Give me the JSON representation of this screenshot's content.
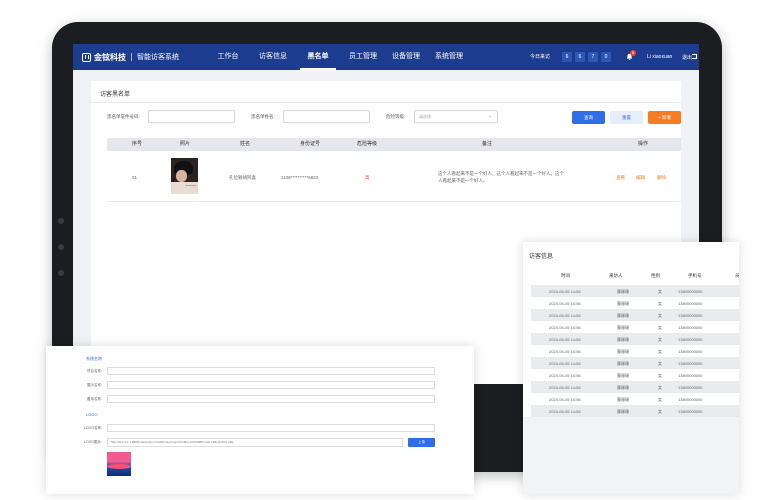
{
  "topbar": {
    "brand_name": "金铉科技",
    "brand_sub": "智能访客系统",
    "nav": [
      "工作台",
      "访客信息",
      "黑名单",
      "员工管理",
      "设备管理",
      "系统管理"
    ],
    "active_nav": "黑名单",
    "count_label": "今日来访",
    "count_digits": [
      "6",
      "6",
      "7",
      "0"
    ],
    "notification_count": "5",
    "user_name": "Li xiaoxuan",
    "logout_label": "退出"
  },
  "blacklist": {
    "title": "访客黑名单",
    "filters": {
      "id_label": "黑名单证件号码:",
      "name_label": "黑名单姓名:",
      "level_label": "危险等级:",
      "level_placeholder": "请选择"
    },
    "buttons": {
      "search": "查询",
      "reset": "重置",
      "add": "+ 新增"
    },
    "columns": [
      "序号",
      "照片",
      "姓名",
      "身份证号",
      "危险等级",
      "备注",
      "操作"
    ],
    "rows": [
      {
        "index": "01",
        "name": "孔位颖胡阿喜",
        "id_number": "1108**********6823",
        "level": "高",
        "remark": "这个人看起来不是一个好人。这个人看起来不是一个好人。这个人看起来不是一个好人。",
        "actions": [
          "查看",
          "编辑",
          "删除"
        ]
      }
    ]
  },
  "settings_card": {
    "section_title": "系统名称",
    "fields": [
      "项目名称:",
      "展示名称:",
      "备用名称:"
    ],
    "logo_section": "LOGO",
    "logo_fields": [
      "LOGO名称:",
      "LOGO图片:"
    ],
    "logo_url": "http://127.0.1.1:8080/static/index.html#/index/logo?t=e48a.nkW%5B8=uA6.7aB1pOPC1+8Q",
    "upload_label": "上传"
  },
  "visitor_card": {
    "title": "访客信息",
    "columns": [
      "时间",
      "来访人",
      "性别",
      "手机号",
      "员"
    ],
    "rows": [
      [
        "2024-06-05  14:56",
        "曹珊珊",
        "女",
        "13800000000"
      ],
      [
        "2024-06-05  14:56",
        "曹珊珊",
        "女",
        "13800000000"
      ],
      [
        "2024-06-05  14:56",
        "曹珊珊",
        "女",
        "13800000000"
      ],
      [
        "2024-06-05  14:56",
        "曹珊珊",
        "女",
        "13800000000"
      ],
      [
        "2024-06-05  14:56",
        "曹珊珊",
        "女",
        "13800000000"
      ],
      [
        "2024-06-05  14:56",
        "曹珊珊",
        "女",
        "13800000000"
      ],
      [
        "2024-06-05  14:56",
        "曹珊珊",
        "女",
        "13800000000"
      ],
      [
        "2024-06-05  14:56",
        "曹珊珊",
        "女",
        "13800000000"
      ],
      [
        "2024-06-05  14:56",
        "曹珊珊",
        "女",
        "13800000000"
      ],
      [
        "2024-06-05  14:56",
        "曹珊珊",
        "女",
        "13800000000"
      ],
      [
        "2024-06-05  14:56",
        "曹珊珊",
        "女",
        "13800000000"
      ]
    ]
  },
  "colors": {
    "nav": "#1c3d8f",
    "primary": "#2f6ee8",
    "accent": "#f57c23",
    "danger": "#f0452f"
  },
  "icons": [
    "logo-icon",
    "bell-icon",
    "logout-icon",
    "chevron-down-icon"
  ]
}
